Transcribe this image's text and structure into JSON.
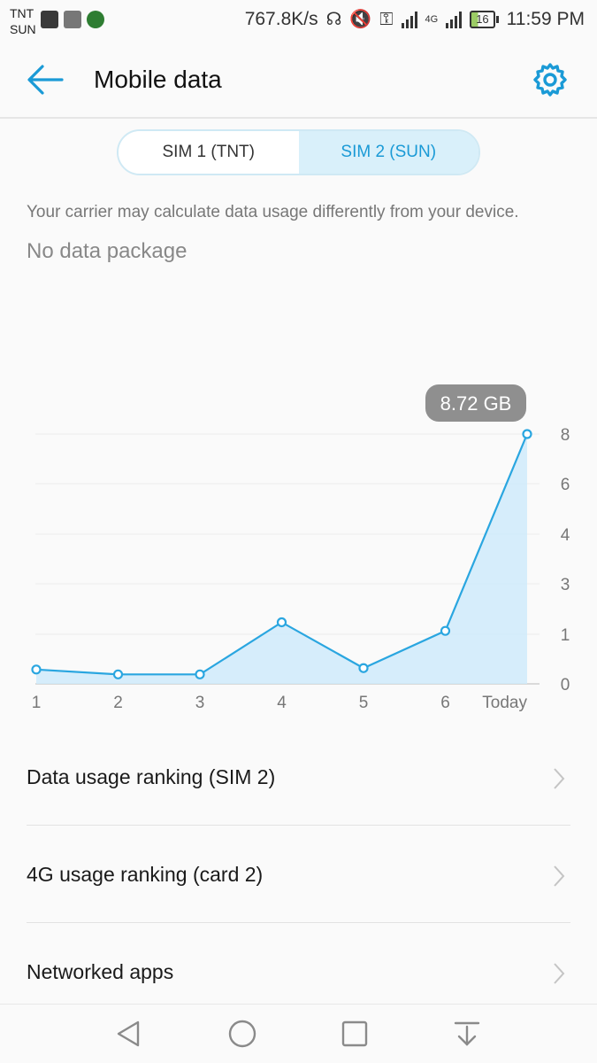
{
  "status_bar": {
    "carrier_1": "TNT",
    "carrier_2": "SUN",
    "speed": "767.8K/s",
    "network": "4G",
    "battery": "16",
    "time": "11:59 PM"
  },
  "header": {
    "title": "Mobile data"
  },
  "tabs": [
    {
      "label": "SIM 1 (TNT)",
      "selected": false
    },
    {
      "label": "SIM 2 (SUN)",
      "selected": true
    }
  ],
  "notice": "Your carrier may calculate data usage differently from your device.",
  "package_status": "No data package",
  "chart_data": {
    "type": "area",
    "categories": [
      "1",
      "2",
      "3",
      "4",
      "5",
      "6",
      "Today"
    ],
    "values": [
      0.5,
      0.33,
      0.33,
      2.15,
      0.55,
      1.85,
      8.72
    ],
    "y_tick_labels": [
      "0",
      "1",
      "3",
      "4",
      "6",
      "8"
    ],
    "callout": "8.72 GB",
    "grid": true,
    "line_color": "#2aa6e0",
    "fill_color": "#cfeafa"
  },
  "list": [
    {
      "label": "Data usage ranking (SIM 2)"
    },
    {
      "label": "4G usage ranking (card 2)"
    },
    {
      "label": "Networked apps"
    }
  ],
  "colors": {
    "accent": "#1a9ad6",
    "tab_selected_bg": "#d9f0fa"
  }
}
